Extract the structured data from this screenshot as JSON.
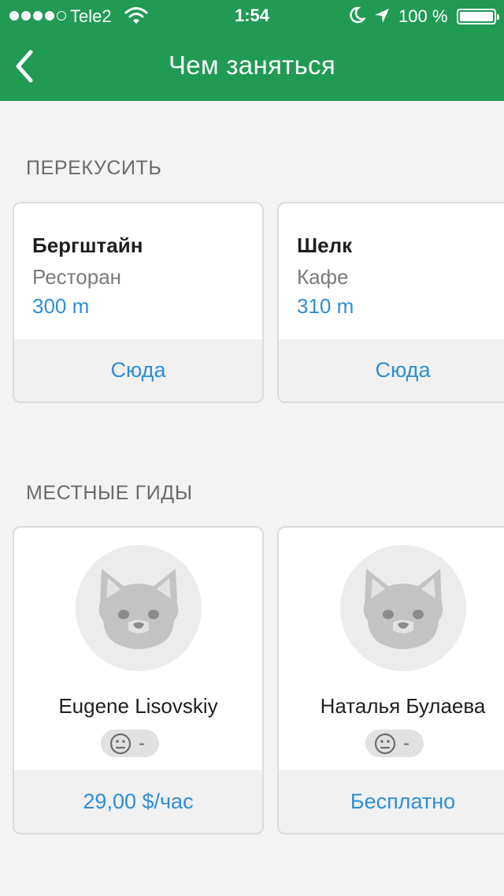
{
  "status_bar": {
    "carrier": "Tele2",
    "time": "1:54",
    "battery": "100 %"
  },
  "nav": {
    "title": "Чем заняться"
  },
  "snacks": {
    "title": "ПЕРЕКУСИТЬ",
    "cards": [
      {
        "name": "Бергштайн",
        "type": "Ресторан",
        "distance": "300 m",
        "action": "Сюда"
      },
      {
        "name": "Шелк",
        "type": "Кафе",
        "distance": "310 m",
        "action": "Сюда"
      }
    ]
  },
  "guides": {
    "title": "МЕСТНЫЕ ГИДЫ",
    "cards": [
      {
        "name": "Eugene Lisovskiy",
        "rating": "-",
        "price": "29,00 $/час"
      },
      {
        "name": "Наталья Булаева",
        "rating": "-",
        "price": "Бесплатно"
      }
    ]
  },
  "colors": {
    "header": "#219a54",
    "link": "#2d8fd5"
  }
}
